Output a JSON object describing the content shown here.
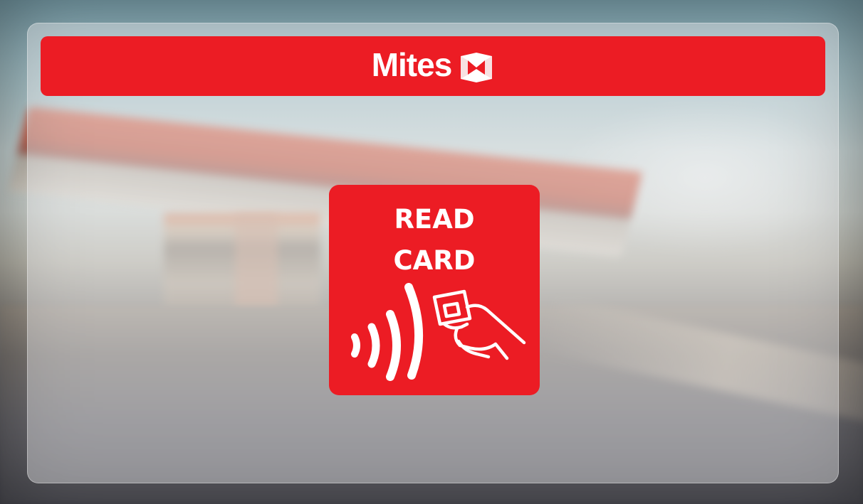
{
  "header": {
    "brand_name": "Mites",
    "logo_icon": "mites-logo-icon"
  },
  "tile": {
    "title": "READ\nCARD",
    "icon": "contactless-card-tap-icon"
  },
  "colors": {
    "accent": "#ec1c24",
    "on_accent": "#ffffff",
    "panel": "#ebebee"
  }
}
